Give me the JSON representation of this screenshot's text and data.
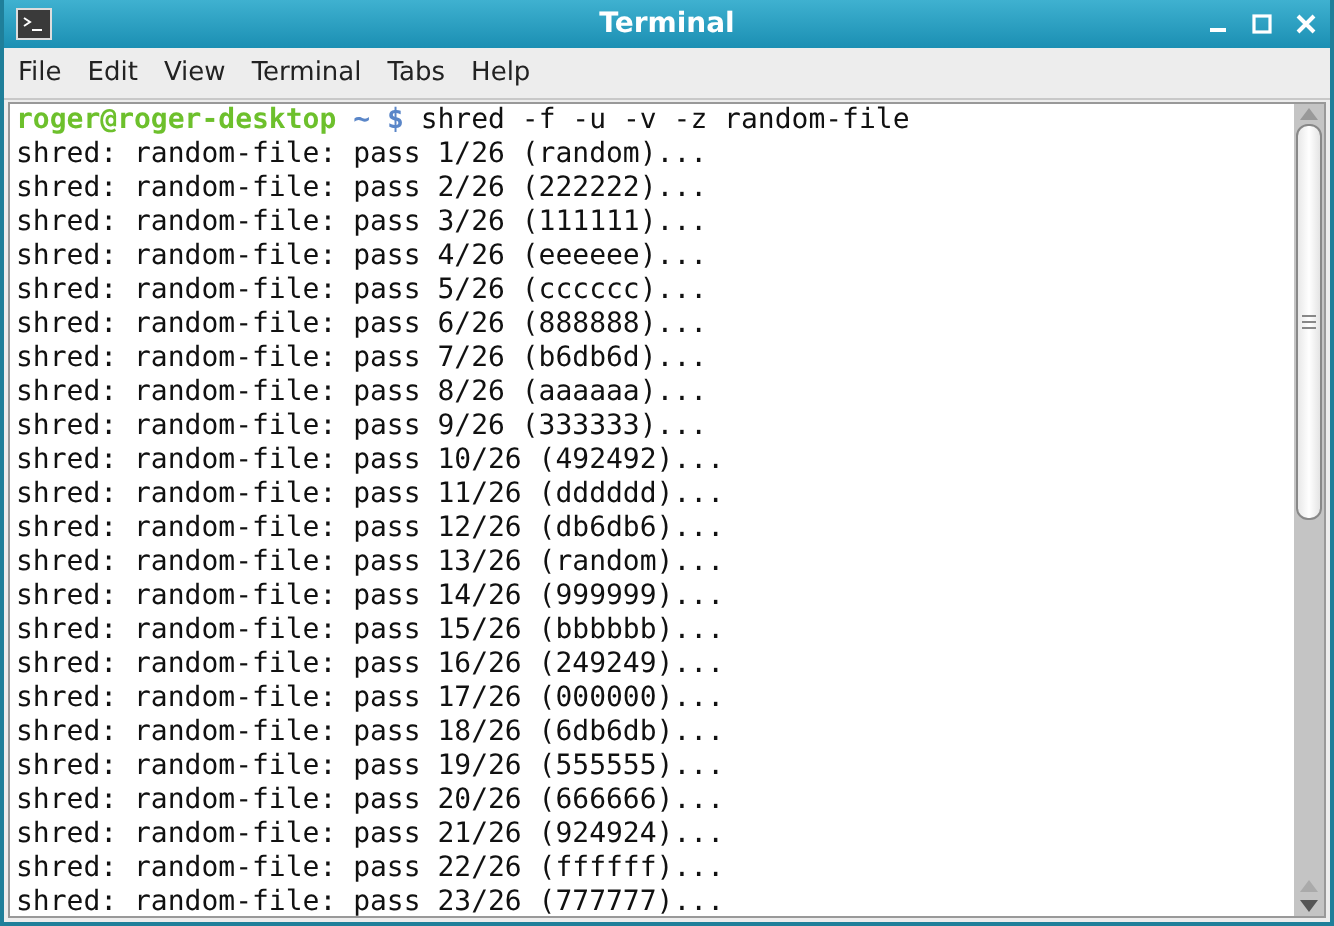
{
  "window": {
    "title": "Terminal"
  },
  "menu": [
    "File",
    "Edit",
    "View",
    "Terminal",
    "Tabs",
    "Help"
  ],
  "prompt": {
    "user_host": "roger@roger-desktop",
    "path": "~ $",
    "command": "shred -f -u -v -z random-file"
  },
  "output": [
    "shred: random-file: pass 1/26 (random)...",
    "shred: random-file: pass 2/26 (222222)...",
    "shred: random-file: pass 3/26 (111111)...",
    "shred: random-file: pass 4/26 (eeeeee)...",
    "shred: random-file: pass 5/26 (cccccc)...",
    "shred: random-file: pass 6/26 (888888)...",
    "shred: random-file: pass 7/26 (b6db6d)...",
    "shred: random-file: pass 8/26 (aaaaaa)...",
    "shred: random-file: pass 9/26 (333333)...",
    "shred: random-file: pass 10/26 (492492)...",
    "shred: random-file: pass 11/26 (dddddd)...",
    "shred: random-file: pass 12/26 (db6db6)...",
    "shred: random-file: pass 13/26 (random)...",
    "shred: random-file: pass 14/26 (999999)...",
    "shred: random-file: pass 15/26 (bbbbbb)...",
    "shred: random-file: pass 16/26 (249249)...",
    "shred: random-file: pass 17/26 (000000)...",
    "shred: random-file: pass 18/26 (6db6db)...",
    "shred: random-file: pass 19/26 (555555)...",
    "shred: random-file: pass 20/26 (666666)...",
    "shred: random-file: pass 21/26 (924924)...",
    "shred: random-file: pass 22/26 (ffffff)...",
    "shred: random-file: pass 23/26 (777777)..."
  ]
}
